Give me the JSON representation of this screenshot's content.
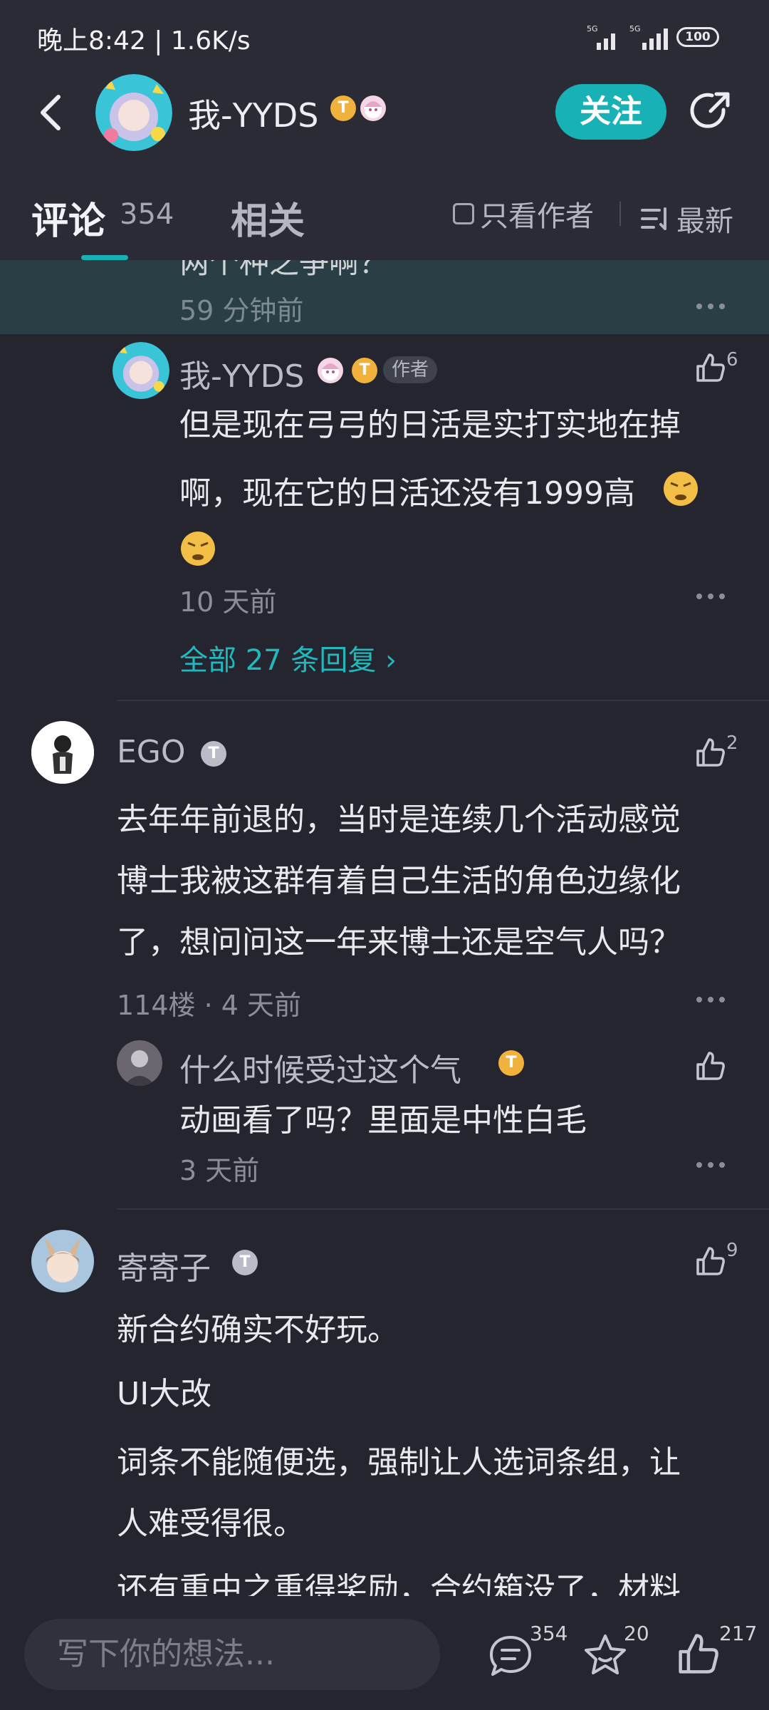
{
  "status_bar": {
    "time": "晚上8:42 | 1.6K/s",
    "signal_label_a": "5G",
    "signal_label_b": "5G",
    "battery": "100"
  },
  "header": {
    "title": "我-YYDS",
    "follow_label": "关注",
    "badge_letter": "T"
  },
  "tabs": {
    "comments_label": "评论",
    "comments_count": "354",
    "related_label": "相关",
    "author_only_label": "只看作者",
    "sort_label": "最新"
  },
  "highlight": {
    "cut_text": "两个种之争啊？",
    "time": "59 分钟前"
  },
  "reply": {
    "name": "我-YYDS",
    "author_tag": "作者",
    "likes": "6",
    "body_1": "但是现在弓弓的日活是实打实地在掉",
    "body_2": "啊，现在它的日活还没有1999高",
    "time": "10 天前",
    "view_all": "全部 27 条回复 ›"
  },
  "comments": [
    {
      "name": "EGO",
      "likes": "2",
      "lines": [
        "去年年前退的，当时是连续几个活动感觉",
        "博士我被这群有着自己生活的角色边缘化",
        "了，想问问这一年来博士还是空气人吗？"
      ],
      "meta": "114楼 · 4 天前",
      "nested": {
        "name": "什么时候受过这个气",
        "body": "动画看了吗？里面是中性白毛",
        "time": "3 天前"
      }
    },
    {
      "name": "寄寄子",
      "likes": "9",
      "lines": [
        "新合约确实不好玩。",
        "UI大改",
        "词条不能随便选，强制让人选词条组，让",
        "人难受得很。",
        "还有重中之重得奖励，合约箱没了，材料"
      ]
    }
  ],
  "bottom_bar": {
    "input_placeholder": "写下你的想法...",
    "comment_count": "354",
    "favorite_count": "20",
    "like_count": "217"
  },
  "colors": {
    "accent": "#17b1b6",
    "background": "#24252f",
    "header_bg": "#2a2b35",
    "highlight_bg": "#293f45"
  }
}
